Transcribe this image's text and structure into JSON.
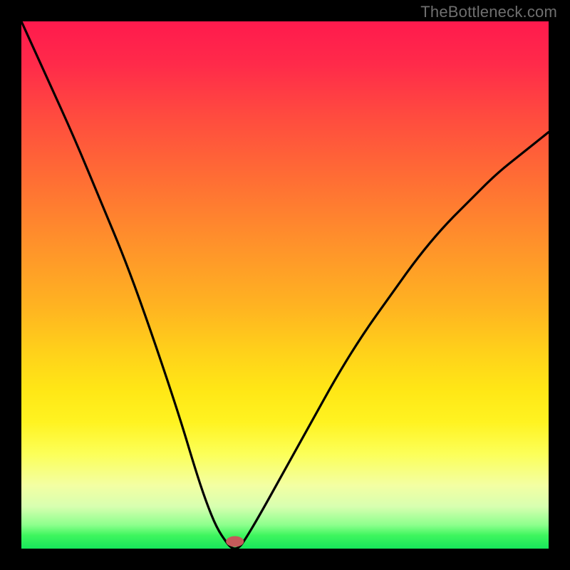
{
  "watermark": "TheBottleneck.com",
  "chart_data": {
    "type": "line",
    "title": "",
    "xlabel": "",
    "ylabel": "",
    "xlim": [
      0,
      100
    ],
    "ylim": [
      0,
      100
    ],
    "grid": false,
    "legend": false,
    "background": "rainbow-vertical-gradient",
    "series": [
      {
        "name": "bottleneck-curve",
        "x": [
          0,
          5,
          10,
          15,
          20,
          25,
          30,
          33,
          35,
          37,
          39,
          40,
          41,
          42,
          45,
          50,
          55,
          60,
          65,
          70,
          75,
          80,
          85,
          90,
          95,
          100
        ],
        "y": [
          100,
          89,
          78,
          66,
          54,
          40,
          25,
          15,
          9,
          4,
          1,
          0,
          0,
          1,
          6,
          15,
          24,
          33,
          41,
          48,
          55,
          61,
          66,
          71,
          75,
          79
        ]
      }
    ],
    "trough_marker": {
      "x": 40.5,
      "y": 0
    },
    "colors": {
      "frame": "#000000",
      "curve": "#000000",
      "trough_marker": "#c45a5a",
      "gradient_top": "#ff1a4d",
      "gradient_bottom": "#17e75b"
    }
  }
}
